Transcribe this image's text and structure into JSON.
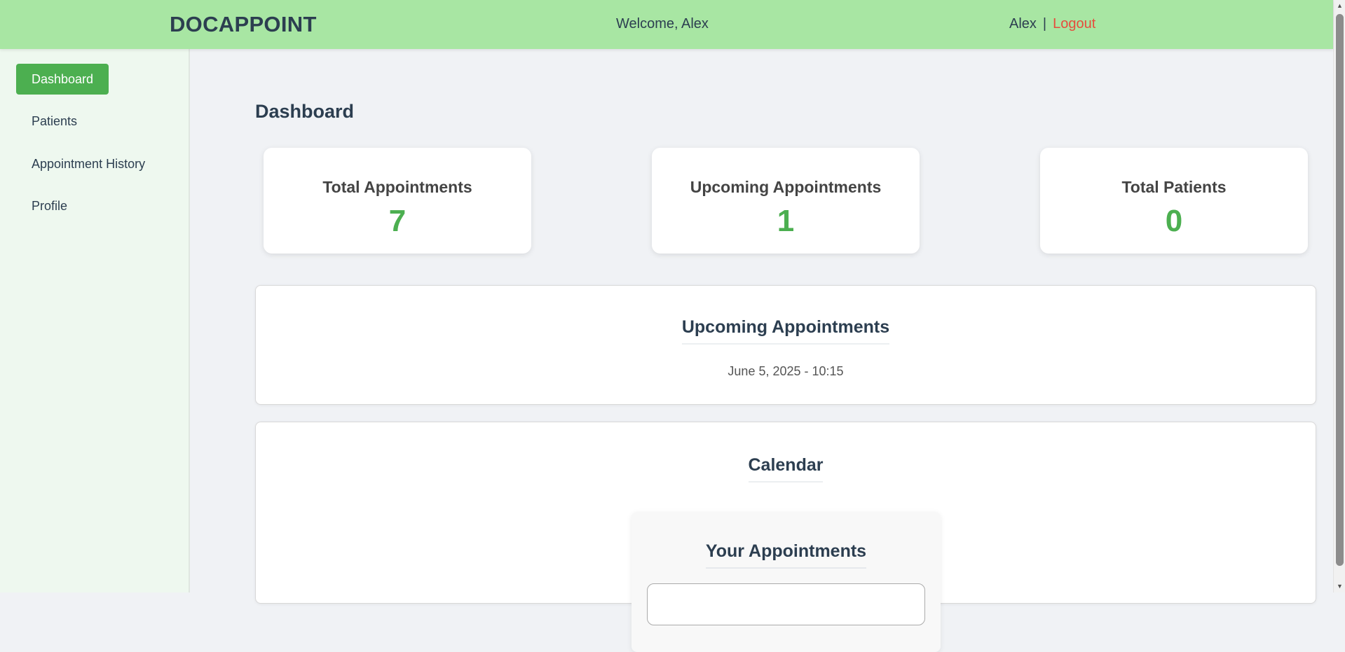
{
  "header": {
    "brand": "DOCAPPOINT",
    "welcome": "Welcome, Alex",
    "username": "Alex",
    "separator": "|",
    "logout_label": "Logout"
  },
  "sidebar": {
    "items": [
      {
        "label": "Dashboard",
        "active": true
      },
      {
        "label": "Patients",
        "active": false
      },
      {
        "label": "Appointment History",
        "active": false
      },
      {
        "label": "Profile",
        "active": false
      }
    ]
  },
  "main": {
    "title": "Dashboard",
    "stats": [
      {
        "label": "Total Appointments",
        "value": "7"
      },
      {
        "label": "Upcoming Appointments",
        "value": "1"
      },
      {
        "label": "Total Patients",
        "value": "0"
      }
    ],
    "upcoming": {
      "title": "Upcoming Appointments",
      "items": [
        "June 5, 2025 - 10:15"
      ]
    },
    "calendar": {
      "title": "Calendar",
      "card_title": "Your Appointments"
    }
  },
  "colors": {
    "header_bg": "#a8e6a3",
    "accent": "#4caf50",
    "logout": "#e74c3c",
    "sidebar_bg": "#eef8ef",
    "page_bg": "#f0f2f5"
  },
  "icons": {
    "scroll_up": "scroll-up-arrow-icon",
    "scroll_down": "scroll-down-arrow-icon"
  }
}
